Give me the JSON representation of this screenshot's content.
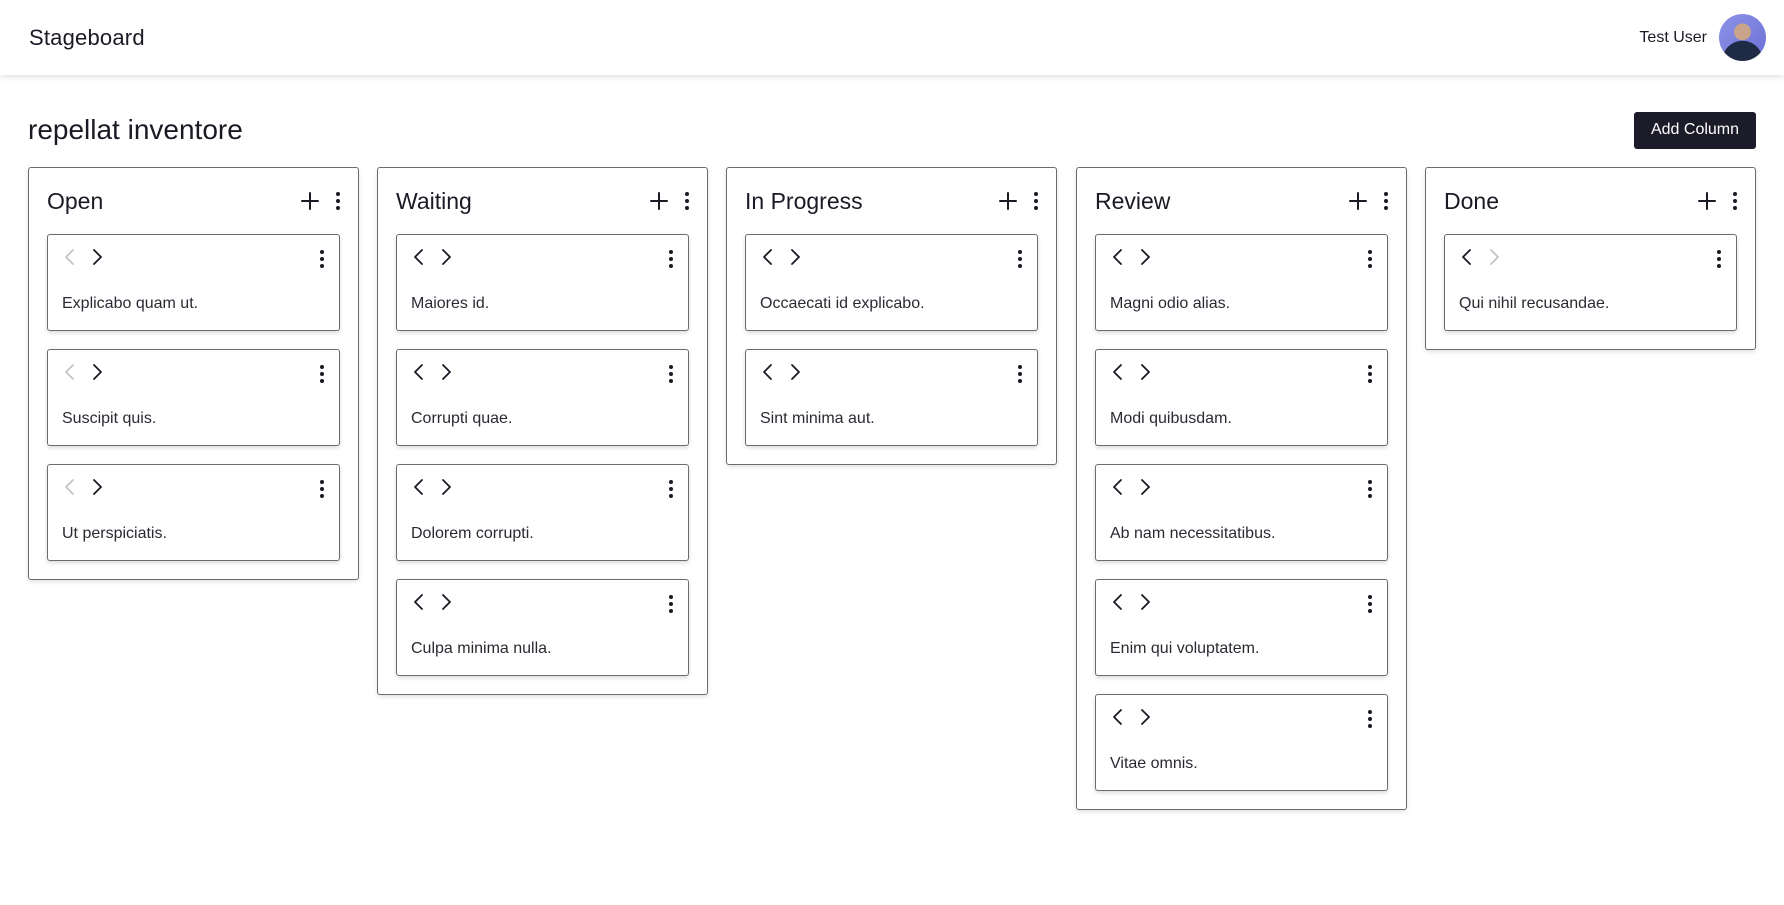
{
  "app": {
    "title": "Stageboard"
  },
  "user": {
    "name": "Test User"
  },
  "board": {
    "title": "repellat inventore",
    "add_column_label": "Add Column"
  },
  "colors": {
    "primary_button": "#1b1b2a",
    "border": "#6b6b72",
    "disabled_icon": "#c4c4c8"
  },
  "icons": {
    "add": "plus-icon",
    "menu": "kebab-menu-icon",
    "prev": "chevron-left-icon",
    "next": "chevron-right-icon"
  },
  "columns": [
    {
      "title": "Open",
      "cards": [
        {
          "text": "Explicabo quam ut.",
          "prev_disabled": true,
          "next_disabled": false
        },
        {
          "text": "Suscipit quis.",
          "prev_disabled": true,
          "next_disabled": false
        },
        {
          "text": "Ut perspiciatis.",
          "prev_disabled": true,
          "next_disabled": false
        }
      ]
    },
    {
      "title": "Waiting",
      "cards": [
        {
          "text": "Maiores id.",
          "prev_disabled": false,
          "next_disabled": false
        },
        {
          "text": "Corrupti quae.",
          "prev_disabled": false,
          "next_disabled": false
        },
        {
          "text": "Dolorem corrupti.",
          "prev_disabled": false,
          "next_disabled": false
        },
        {
          "text": "Culpa minima nulla.",
          "prev_disabled": false,
          "next_disabled": false
        }
      ]
    },
    {
      "title": "In Progress",
      "cards": [
        {
          "text": "Occaecati id explicabo.",
          "prev_disabled": false,
          "next_disabled": false
        },
        {
          "text": "Sint minima aut.",
          "prev_disabled": false,
          "next_disabled": false
        }
      ]
    },
    {
      "title": "Review",
      "cards": [
        {
          "text": "Magni odio alias.",
          "prev_disabled": false,
          "next_disabled": false
        },
        {
          "text": "Modi quibusdam.",
          "prev_disabled": false,
          "next_disabled": false
        },
        {
          "text": "Ab nam necessitatibus.",
          "prev_disabled": false,
          "next_disabled": false
        },
        {
          "text": "Enim qui voluptatem.",
          "prev_disabled": false,
          "next_disabled": false
        },
        {
          "text": "Vitae omnis.",
          "prev_disabled": false,
          "next_disabled": false
        }
      ]
    },
    {
      "title": "Done",
      "cards": [
        {
          "text": "Qui nihil recusandae.",
          "prev_disabled": false,
          "next_disabled": true
        }
      ]
    }
  ]
}
